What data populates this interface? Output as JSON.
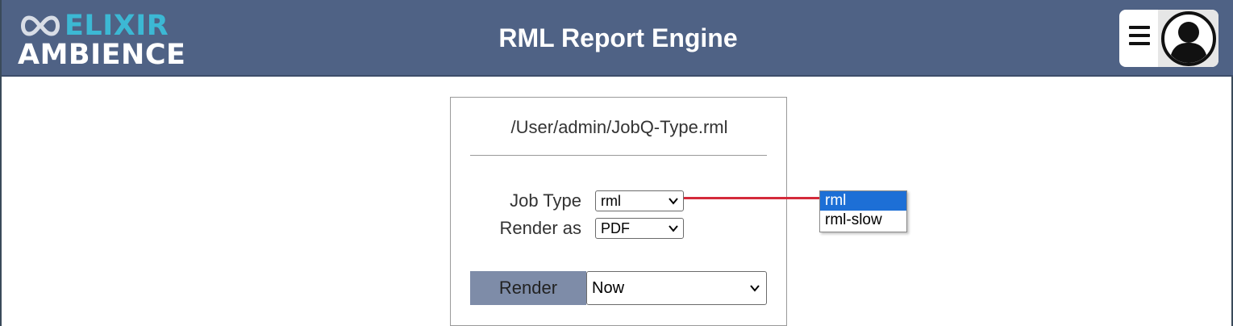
{
  "header": {
    "title": "RML Report Engine",
    "logo": {
      "line1": "ELIXIR",
      "line2": "AMBIENCE",
      "icon": "infinity-loop-logo"
    },
    "menu_icon": "hamburger-menu-icon",
    "avatar_icon": "user-avatar-icon"
  },
  "form": {
    "file_path": "/User/admin/JobQ-Type.rml",
    "job_type": {
      "label": "Job Type",
      "value": "rml",
      "options": [
        "rml",
        "rml-slow"
      ],
      "highlighted": "rml"
    },
    "render_as": {
      "label": "Render as",
      "value": "PDF"
    },
    "render_button": "Render",
    "schedule": {
      "value": "Now"
    }
  },
  "colors": {
    "header_bg": "#4f6285",
    "logo_accent": "#3cb8d4",
    "render_button_bg": "#7e8ca8",
    "highlight": "#1d6fd6",
    "connector": "#d42a3a"
  }
}
